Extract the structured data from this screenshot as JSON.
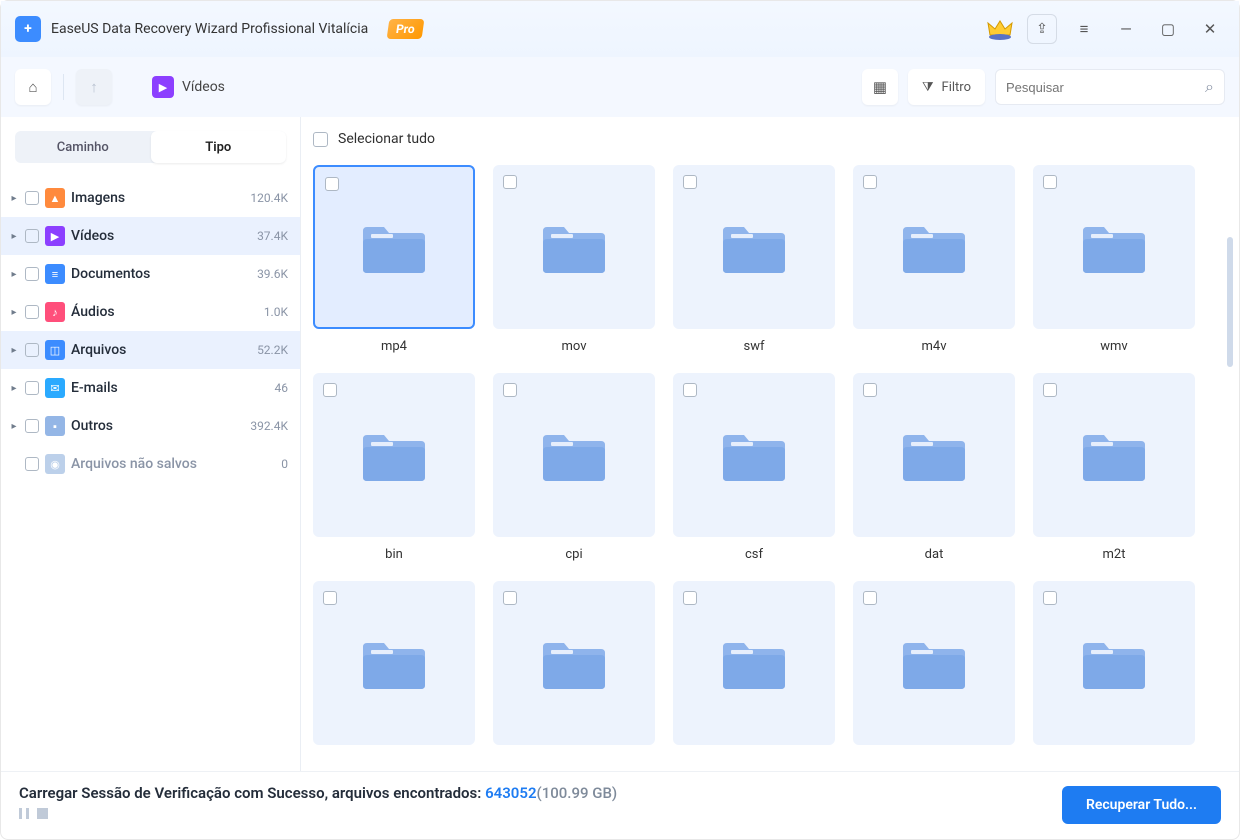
{
  "titlebar": {
    "title": "EaseUS Data Recovery Wizard Profissional Vitalícia",
    "pro_badge": "Pro"
  },
  "toolbar": {
    "breadcrumb_label": "Vídeos",
    "filter_label": "Filtro",
    "search_placeholder": "Pesquisar"
  },
  "sidebar": {
    "segment_left": "Caminho",
    "segment_right": "Tipo",
    "items": [
      {
        "label": "Imagens",
        "count": "120.4K",
        "icon": "image",
        "color": "#ff8a3d",
        "selected": false
      },
      {
        "label": "Vídeos",
        "count": "37.4K",
        "icon": "video",
        "color": "#8c3fff",
        "selected": true
      },
      {
        "label": "Documentos",
        "count": "39.6K",
        "icon": "doc",
        "color": "#3c8cff",
        "selected": false
      },
      {
        "label": "Áudios",
        "count": "1.0K",
        "icon": "audio",
        "color": "#ff4f7b",
        "selected": false
      },
      {
        "label": "Arquivos",
        "count": "52.2K",
        "icon": "archive",
        "color": "#3c8cff",
        "selected": true
      },
      {
        "label": "E-mails",
        "count": "46",
        "icon": "email",
        "color": "#2aaaff",
        "selected": false
      },
      {
        "label": "Outros",
        "count": "392.4K",
        "icon": "other",
        "color": "#94b6e6",
        "selected": false
      }
    ],
    "unsaved": {
      "label": "Arquivos não salvos",
      "count": "0"
    }
  },
  "content": {
    "select_all_label": "Selecionar tudo",
    "folders": [
      {
        "label": "mp4",
        "selected": true
      },
      {
        "label": "mov",
        "selected": false
      },
      {
        "label": "swf",
        "selected": false
      },
      {
        "label": "m4v",
        "selected": false
      },
      {
        "label": "wmv",
        "selected": false
      },
      {
        "label": "bin",
        "selected": false
      },
      {
        "label": "cpi",
        "selected": false
      },
      {
        "label": "csf",
        "selected": false
      },
      {
        "label": "dat",
        "selected": false
      },
      {
        "label": "m2t",
        "selected": false
      },
      {
        "label": "",
        "selected": false
      },
      {
        "label": "",
        "selected": false
      },
      {
        "label": "",
        "selected": false
      },
      {
        "label": "",
        "selected": false
      },
      {
        "label": "",
        "selected": false
      }
    ]
  },
  "footer": {
    "prefix": "Carregar Sessão de Verificação com Sucesso, arquivos encontrados: ",
    "count": "643052",
    "size": "(100.99 GB)",
    "recover_button": "Recuperar Tudo..."
  },
  "icons": {
    "home": "⌂",
    "up": "↑",
    "grid": "▦",
    "funnel": "⧩",
    "search": "⌕",
    "menu": "≡",
    "share": "⇪",
    "minimize": "—",
    "maximize": "▢",
    "close": "✕",
    "crown": "👑",
    "play": "▶"
  },
  "colors": {
    "accent": "#1e7cf2",
    "folder": "#7ea9e8",
    "panel": "#edf3fd"
  }
}
